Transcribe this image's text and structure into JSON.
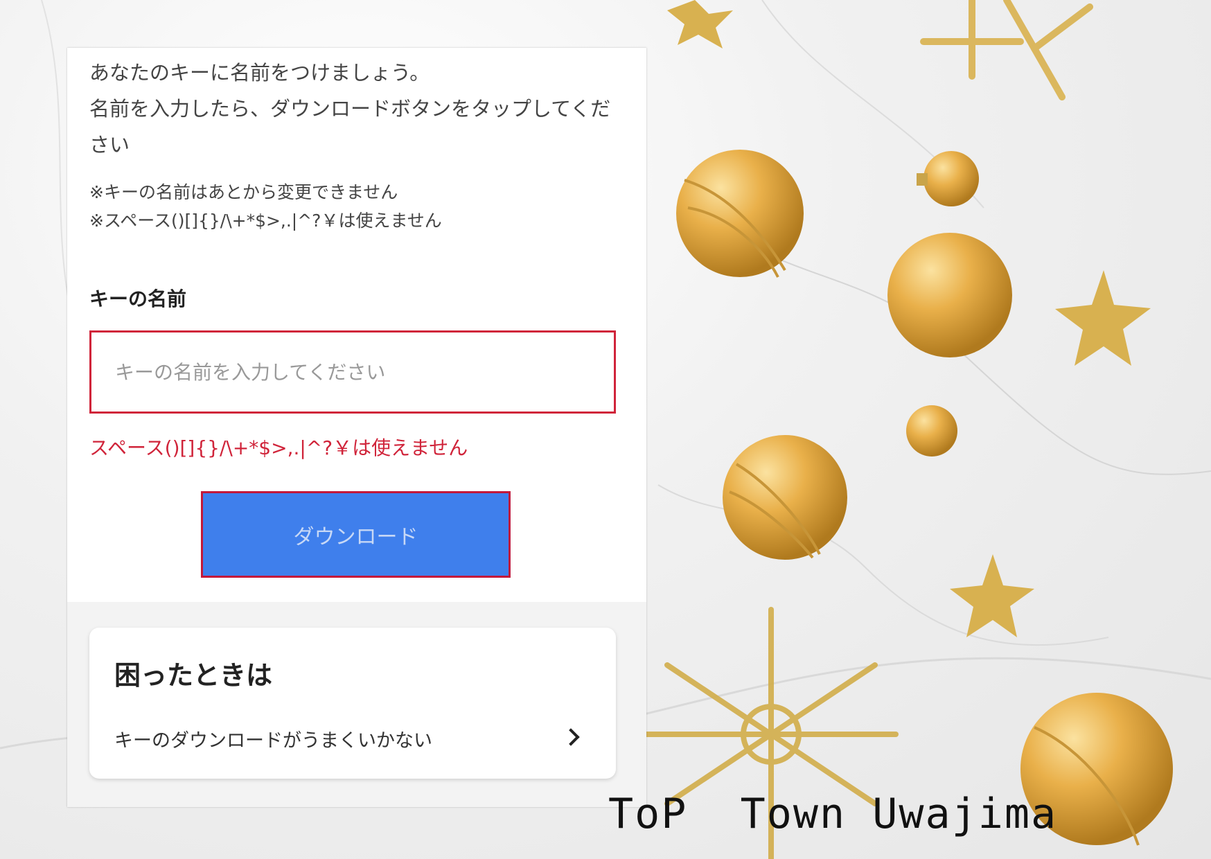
{
  "intro": {
    "line1": "あなたのキーに名前をつけましょう。",
    "line2": "名前を入力したら、ダウンロードボタンをタップしてください"
  },
  "notes": {
    "line1": "※キーの名前はあとから変更できません",
    "line2": "※スペース()[]{}/\\+*$>,.|^?￥は使えません"
  },
  "form": {
    "label": "キーの名前",
    "placeholder": "キーの名前を入力してください",
    "value": "",
    "error": "スペース()[]{}/\\+*$>,.|^?￥は使えません",
    "download_label": "ダウンロード"
  },
  "help": {
    "title": "困ったときは",
    "link_label": "キーのダウンロードがうまくいかない"
  },
  "brand": "ToP  Town Uwajima",
  "colors": {
    "error_red": "#d0243a",
    "button_blue": "#3f7fec",
    "ornament_gold": "#e3a93a"
  },
  "icons": {
    "help_link": "chevron-right-icon"
  }
}
